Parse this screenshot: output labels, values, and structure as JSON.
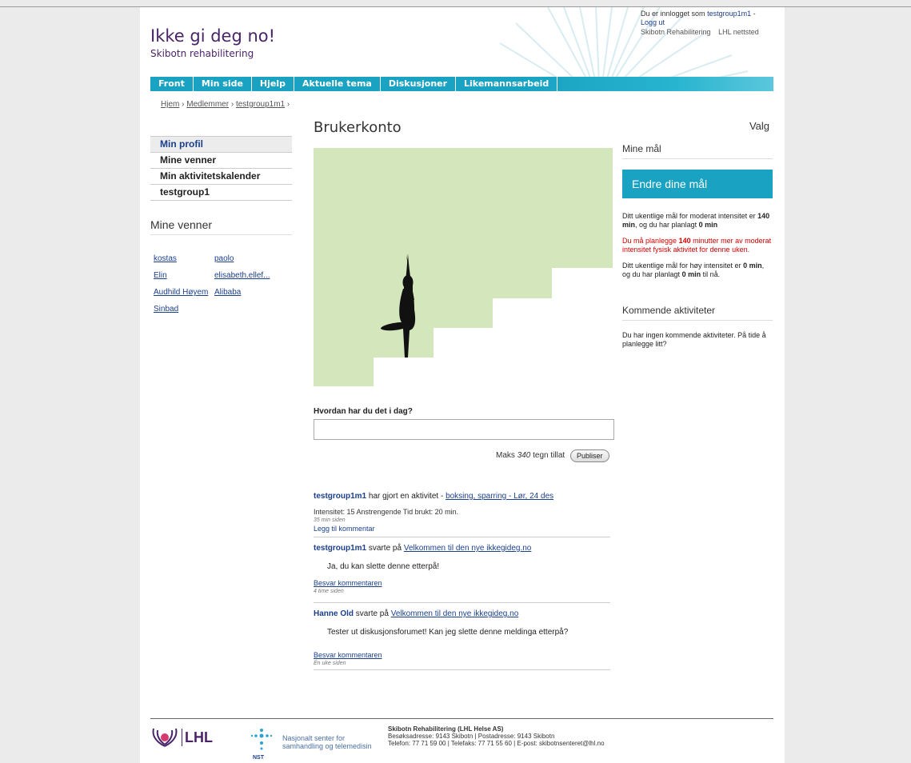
{
  "site": {
    "title": "Ikke gi deg no!",
    "subtitle": "Skibotn rehabilitering"
  },
  "user_bar": {
    "logged_in_prefix": "Du er innlogget som",
    "username": "testgroup1m1",
    "dash": "-",
    "logout": "Logg ut",
    "site_links": [
      "Skibotn Rehabilitering",
      "LHL nettsted"
    ]
  },
  "nav": {
    "items": [
      "Front",
      "Min side",
      "Hjelp",
      "Aktuelle tema",
      "Diskusjoner",
      "Likemannsarbeid"
    ]
  },
  "breadcrumb": {
    "items": [
      "Hjem",
      "Medlemmer",
      "testgroup1m1"
    ],
    "separator": "›"
  },
  "left_nav": {
    "items": [
      "Min profil",
      "Mine venner",
      "Min aktivitetskalender",
      "testgroup1"
    ]
  },
  "friends": {
    "heading": "Mine venner",
    "list": [
      "kostas",
      "paolo",
      "Elin",
      "elisabeth.ellef...",
      "Audhild Høyem",
      "Alibaba",
      "Sinbad"
    ]
  },
  "main": {
    "title": "Brukerkonto",
    "valg": "Valg",
    "status_question": "Hvordan har du det i dag?",
    "status_value": "",
    "max_prefix": "Maks",
    "max_count": "340",
    "max_suffix": "tegn tillat",
    "publish_label": "Publiser"
  },
  "feed": [
    {
      "user": "testgroup1m1",
      "action": "har gjort en aktivitet -",
      "link": "boksing, sparring - Lør, 24 des",
      "detail": "Intensitet: 15 Anstrengende  Tid brukt: 20 min.",
      "time": "35 min siden",
      "comment_link": "Legg til kommentar"
    },
    {
      "user": "testgroup1m1",
      "action": "svarte på",
      "link": "Velkommen til den nye ikkegideg.no",
      "quote": "Ja, du kan slette denne etterpå!",
      "reply_link": "Besvar kommentaren",
      "time": "4 time siden"
    },
    {
      "user": "Hanne Old",
      "action": "svarte på",
      "link": "Velkommen til den nye ikkegideg.no",
      "quote": "Tester ut diskusjonsforumet! Kan jeg slette denne meldinga etterpå?",
      "reply_link": "Besvar kommentaren",
      "time": "Én uke siden"
    }
  ],
  "goals": {
    "heading": "Mine mål",
    "button_label": "Endre dine mål",
    "p1_a": "Ditt ukentlige mål for moderat intensitet er",
    "p1_b": "140 min",
    "p1_c": ", og du har planlagt",
    "p1_d": "0 min",
    "p2_a": "Du må planlegge",
    "p2_b": "140",
    "p2_c": "minutter mer av moderat intensitet fysisk aktivitet for denne uken.",
    "p3_a": "Ditt ukentlige mål for høy intensitet er",
    "p3_b": "0 min",
    "p3_c": ", og du har planlagt",
    "p3_d": "0 min",
    "p3_e": "til nå."
  },
  "upcoming": {
    "heading": "Kommende aktiviteter",
    "text": "Du har ingen kommende aktiviteter. På tide å planlegge litt?"
  },
  "footer": {
    "lhl": "LHL",
    "nst_line1": "Nasjonalt senter for",
    "nst_line2": "samhandling og telemedisin",
    "nst_label": "NST",
    "org": "Skibotn Rehabilitering (LHL Helse AS)",
    "address": "Besøksadresse: 9143 Skibotn | Postadresse: 9143 Skibotn",
    "contact": "Telefon: 77 71 59 00 | Telefaks: 77 71 55 60 | E-post: skibotnsenteret@lhl.no"
  },
  "colors": {
    "brand_purple": "#4a2469",
    "nav_teal": "#19a2c1",
    "link_blue": "#1b3f8b",
    "alert_red": "#d30000",
    "stairs_green": "#d4e6bb"
  }
}
